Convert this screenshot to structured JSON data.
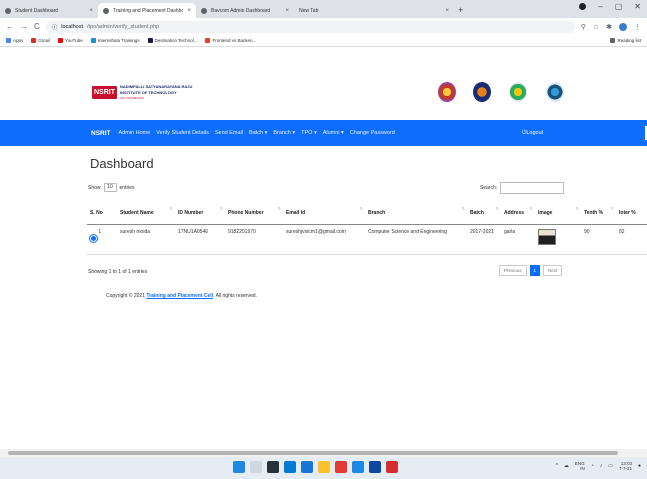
{
  "browser": {
    "tabs": [
      {
        "label": "Student Dashboard",
        "active": false
      },
      {
        "label": "Training and Placement Dashbo...",
        "active": true
      },
      {
        "label": "Bavcom Admin Dashboard",
        "active": false
      },
      {
        "label": "New Tab",
        "active": false
      }
    ],
    "url_host": "localhost",
    "url_path": "/tpo/admin/verify_student.php",
    "bookmarks": [
      "Apps",
      "Gmail",
      "YouTube",
      "Internshala Trainings",
      "Destination Technol...",
      "Frontend vs Backen..."
    ],
    "reading_list": "Reading list"
  },
  "header": {
    "logo_text": "NSRIT",
    "inst_line1": "NADIMPALLI SATYANARAYANA RAJU",
    "inst_line2": "INSTITUTE OF TECHNOLOGY",
    "inst_sub": "(AUTONOMOUS)"
  },
  "nav": {
    "brand": "NSRIT",
    "items": [
      "Admin Home",
      "Verify Student Details",
      "Send Email",
      "Batch ▾",
      "Branch ▾",
      "TPO ▾",
      "Alumni ▾",
      "Change Password"
    ],
    "logout": "Logout"
  },
  "dashboard": {
    "title": "Dashboard",
    "show_label": "Show",
    "show_value": "10",
    "entries_label": "entries",
    "search_label": "Search:",
    "columns": [
      "S. No",
      "Student Name",
      "ID Number",
      "Phone Number",
      "Email Id",
      "Branch",
      "Batch",
      "Address",
      "Image",
      "Tenth %",
      "Inter %"
    ],
    "rows": [
      {
        "sno": "1",
        "name": "suresh moida",
        "id": "17NU1A0546",
        "phone": "9182201970",
        "email": "sureshjvsicrn1@gmail.com",
        "branch": "Computer Science and Engineering",
        "batch": "2017-2021",
        "address": "garla",
        "tenth": "90",
        "inter": "82"
      }
    ],
    "info": "Showing 1 to 1 of 1 entries",
    "pager": {
      "prev": "Previous",
      "current": "1",
      "next": "Next"
    }
  },
  "footer": {
    "prefix": "Copyright © 2021",
    "link": "Training and Placement Cell",
    "suffix": ". All rights reserved."
  },
  "taskbar": {
    "lang": "ENG",
    "lang2": "IN",
    "time": "13:03",
    "date": "7-7-21"
  },
  "colors": {
    "nav_blue": "#0d6efd",
    "brand_red": "#c8102e"
  }
}
